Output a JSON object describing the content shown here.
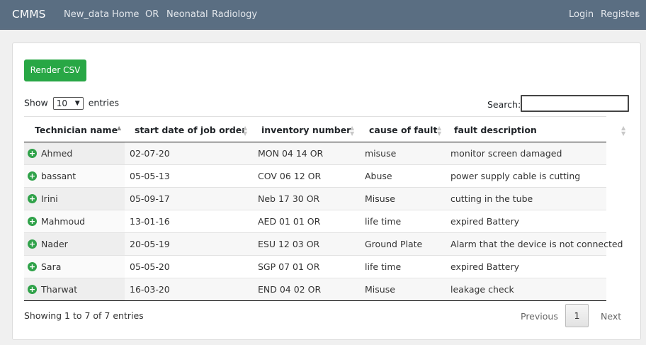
{
  "navbar": {
    "brand": "CMMS",
    "links": [
      "New_data",
      "Home",
      "OR",
      "Neonatal",
      "Radiology"
    ],
    "login": "Login",
    "register": "Register",
    "cut_text": "s"
  },
  "toolbar": {
    "render_csv": "Render CSV"
  },
  "length_menu": {
    "show": "Show",
    "value": "10",
    "entries": "entries"
  },
  "search": {
    "label": "Search:",
    "value": ""
  },
  "table": {
    "columns": [
      "Technician name",
      "start date of job order",
      "inventory number",
      "cause of fault",
      "fault description"
    ],
    "sorted_column": "Technician name",
    "sort_direction": "ascending",
    "rows": [
      [
        "Ahmed",
        "02-07-20",
        "MON 04 14 OR",
        "misuse",
        "monitor screen damaged"
      ],
      [
        "bassant",
        "05-05-13",
        "COV 06 12 OR",
        "Abuse",
        "power supply cable is cutting"
      ],
      [
        "Irini",
        "05-09-17",
        "Neb 17 30 OR",
        "Misuse",
        "cutting in the tube"
      ],
      [
        "Mahmoud",
        "13-01-16",
        "AED 01 01 OR",
        "life time",
        "expired Battery"
      ],
      [
        "Nader",
        "20-05-19",
        "ESU 12 03 OR",
        "Ground Plate",
        "Alarm that the device is not connected"
      ],
      [
        "Sara",
        "05-05-20",
        "SGP 07 01 OR",
        "life time",
        "expired Battery"
      ],
      [
        "Tharwat",
        "16-03-20",
        "END 04 02 OR",
        "Misuse",
        "leakage check"
      ]
    ]
  },
  "footer": {
    "info": "Showing 1 to 7 of 7 entries",
    "previous": "Previous",
    "current_page": "1",
    "next": "Next"
  },
  "colors": {
    "navbar": "#5a6e82",
    "button_success": "#28a745",
    "expand_icon": "#30a24a"
  }
}
